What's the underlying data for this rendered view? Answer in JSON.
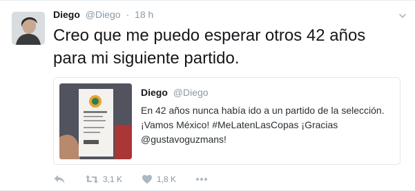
{
  "tweet": {
    "author_name": "Diego",
    "author_handle": "@Diego",
    "separator": "·",
    "timestamp": "18 h",
    "text": "Creo que me puedo esperar otros 42 años para mi siguiente partido."
  },
  "quoted_tweet": {
    "author_name": "Diego",
    "author_handle": "@Diego",
    "text": "En 42 años nunca había ido a un partido de la selección. ¡Vamos México! #MeLatenLasCopas ¡Gracias @gustavoguzmans!"
  },
  "actions": {
    "retweet_count": "3,1 K",
    "like_count": "1,8 K"
  },
  "icons": {
    "reply": "reply-icon",
    "retweet": "retweet-icon",
    "like": "heart-icon",
    "more": "more-icon",
    "caret": "chevron-down-icon"
  },
  "colors": {
    "icon_gray": "#aab8c2",
    "muted_text": "#8899a6",
    "border": "#e1e8ed"
  }
}
